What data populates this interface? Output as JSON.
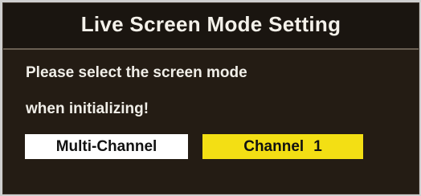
{
  "dialog": {
    "title": "Live Screen Mode Setting",
    "message_line1": "Please select the screen mode",
    "message_line2": "when initializing!"
  },
  "options": {
    "multi_channel": "Multi-Channel",
    "channel_label": "Channel",
    "channel_number": "1",
    "selected": "Channel 1"
  },
  "colors": {
    "background": "#241c14",
    "highlight": "#f3df14",
    "option_bg": "#ffffff",
    "text": "#f0eee8"
  }
}
